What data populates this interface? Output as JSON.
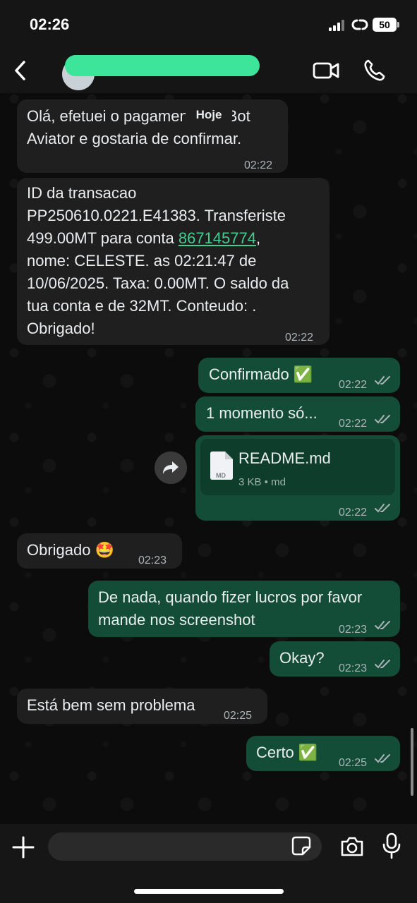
{
  "status_bar": {
    "time": "02:26",
    "battery": "50"
  },
  "header": {
    "contact_name": ""
  },
  "day_separator": "Hoje",
  "messages": [
    {
      "direction": "in",
      "text": "Olá, efetuei o pagamento do Bot\nAviator e gostaria de confirmar.",
      "time": "02:22"
    },
    {
      "direction": "in",
      "text_part1": "ID da transacao\nPP250610.0221.E41383. Transferiste\n499.00MT para conta ",
      "phone": "867145774",
      "text_part2": ",\nnome: CELESTE. as 02:21:47 de\n10/06/2025. Taxa: 0.00MT. O saldo da\ntua conta e de 32MT. Conteudo: .\nObrigado!",
      "time": "02:22"
    },
    {
      "direction": "out",
      "text": "Confirmado ✅",
      "time": "02:22"
    },
    {
      "direction": "out",
      "text": "1 momento só...",
      "time": "02:22"
    },
    {
      "direction": "out",
      "document": {
        "name": "README.md",
        "meta": "3 KB • md",
        "icon_label": "MD"
      },
      "time": "02:22"
    },
    {
      "direction": "in",
      "text": "Obrigado 🤩",
      "time": "02:23"
    },
    {
      "direction": "out",
      "text": "De nada, quando fizer lucros por favor\nmande nos screenshot",
      "time": "02:23"
    },
    {
      "direction": "out",
      "text": "Okay?",
      "time": "02:23"
    },
    {
      "direction": "in",
      "text": "Está bem sem problema",
      "time": "02:25"
    },
    {
      "direction": "out",
      "text": "Certo ✅",
      "time": "02:25"
    }
  ],
  "input": {
    "placeholder": ""
  },
  "icons": [
    "back-chevron-icon",
    "video-call-icon",
    "phone-icon",
    "forward-icon",
    "document-icon",
    "double-check-icon",
    "plus-icon",
    "sticker-icon",
    "camera-icon",
    "microphone-icon"
  ],
  "colors": {
    "incoming": "#1f1f1f",
    "outgoing": "#144d37",
    "link": "#3fcf8e",
    "name_redaction": "#3de59a"
  }
}
